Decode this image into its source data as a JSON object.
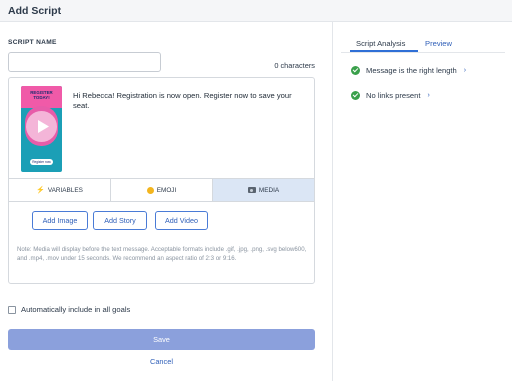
{
  "header": {
    "title": "Add Script"
  },
  "form": {
    "script_name_label": "SCRIPT NAME",
    "script_name_value": "",
    "char_count": "0 characters"
  },
  "editor": {
    "thumbnail": {
      "text": "REGISTER TODAY!",
      "button_text": "Register now"
    },
    "message": "Hi Rebecca! Registration is now open. Register now to save your seat.",
    "tabs": [
      {
        "label": "VARIABLES",
        "icon": "bolt-icon",
        "active": false
      },
      {
        "label": "EMOJI",
        "icon": "smiley-icon",
        "active": false
      },
      {
        "label": "MEDIA",
        "icon": "camera-icon",
        "active": true
      }
    ],
    "media_buttons": [
      "Add Image",
      "Add Story",
      "Add Video"
    ],
    "note": "Note: Media will display before the text message. Acceptable formats include .gif, .jpg, .png, .svg below600, and .mp4, .mov under 15 seconds. We recommend an aspect ratio of 2:3 or 9:16."
  },
  "options": {
    "auto_include_label": "Automatically include in all goals",
    "auto_include_checked": false
  },
  "actions": {
    "save_label": "Save",
    "cancel_label": "Cancel"
  },
  "analysis": {
    "tabs": [
      "Script Analysis",
      "Preview"
    ],
    "active_tab": "Script Analysis",
    "checks": [
      {
        "text": "Message is the right length",
        "status": "pass"
      },
      {
        "text": "No links present",
        "status": "pass"
      }
    ]
  },
  "colors": {
    "accent": "#2f6fd6",
    "save_button": "#8ba0dc",
    "active_tab_bg": "#dbe6f5",
    "pass": "#3aa04b"
  }
}
